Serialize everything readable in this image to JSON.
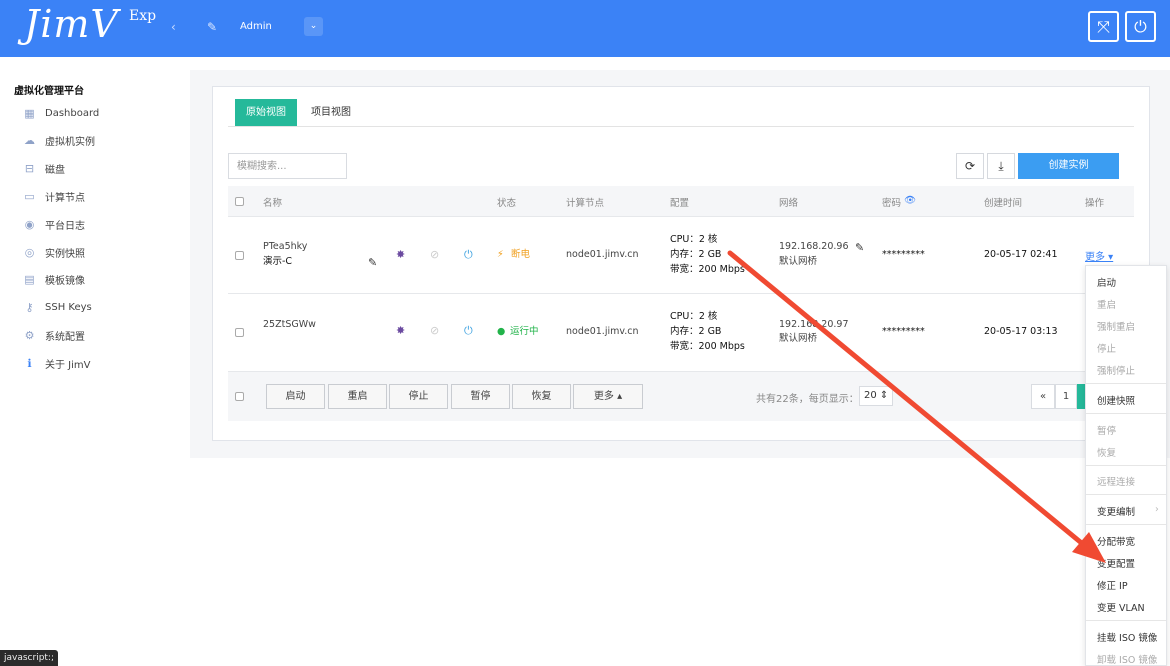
{
  "header": {
    "logo": "JimV",
    "logo_sup": "Exp",
    "collapse_icon": "‹",
    "user_name": "Admin",
    "user_dropdown_icon": "⌄",
    "fullscreen_icon": "⤧",
    "power_icon": "⏻"
  },
  "sidebar": {
    "title": "虚拟化管理平台",
    "items": [
      {
        "label": "Dashboard",
        "icon": "▦"
      },
      {
        "label": "虚拟机实例",
        "icon": "☁"
      },
      {
        "label": "磁盘",
        "icon": "⊟"
      },
      {
        "label": "计算节点",
        "icon": "▭"
      },
      {
        "label": "平台日志",
        "icon": "◉"
      },
      {
        "label": "实例快照",
        "icon": "◎"
      },
      {
        "label": "模板镜像",
        "icon": "▤"
      },
      {
        "label": "SSH Keys",
        "icon": "⚷"
      },
      {
        "label": "系统配置",
        "icon": "⚙"
      },
      {
        "label": "关于 JimV",
        "icon": "ℹ"
      }
    ]
  },
  "tabs": {
    "original": "原始视图",
    "project": "项目视图"
  },
  "toolbar": {
    "search_placeholder": "模糊搜索...",
    "refresh_icon": "⟳",
    "download_icon": "⤓",
    "create_label": "创建实例"
  },
  "table": {
    "headers": {
      "name": "名称",
      "status": "状态",
      "node": "计算节点",
      "config": "配置",
      "network": "网络",
      "password": "密码",
      "created": "创建时间",
      "action": "操作"
    },
    "rows": [
      {
        "name": "PTea5hky",
        "alias": "演示-C",
        "status_icon": "⚡",
        "status": "断电",
        "node": "node01.jimv.cn",
        "cpu": "CPU：2 核",
        "mem": "内存：2 GB",
        "bw": "带宽：200 Mbps",
        "ip": "192.168.20.96",
        "net": "默认网桥",
        "password": "*********",
        "created": "20-05-17 02:41",
        "more": "更多"
      },
      {
        "name": "25ZtSGWw",
        "alias": "",
        "status_icon": "●",
        "status": "运行中",
        "node": "node01.jimv.cn",
        "cpu": "CPU：2 核",
        "mem": "内存：2 GB",
        "bw": "带宽：200 Mbps",
        "ip": "192.168.20.97",
        "net": "默认网桥",
        "password": "*********",
        "created": "20-05-17 03:13",
        "more": ""
      }
    ]
  },
  "footer": {
    "buttons": [
      "启动",
      "重启",
      "停止",
      "暂停",
      "恢复",
      "更多 ▴"
    ],
    "info": "共有22条，每页显示：",
    "page_size": "20",
    "prev": "«",
    "page": "1"
  },
  "dropdown": {
    "items": [
      "启动",
      "重启",
      "强制重启",
      "停止",
      "强制停止",
      "创建快照",
      "暂停",
      "恢复",
      "远程连接",
      "变更编制",
      "分配带宽",
      "变更配置",
      "修正 IP",
      "变更 VLAN",
      "挂载 ISO 镜像",
      "卸载 ISO 镜像"
    ]
  },
  "status_bar": "javascript:;",
  "colors": {
    "primary": "#3b82f6",
    "accent": "#25b99a",
    "arrow": "#f04a32"
  }
}
